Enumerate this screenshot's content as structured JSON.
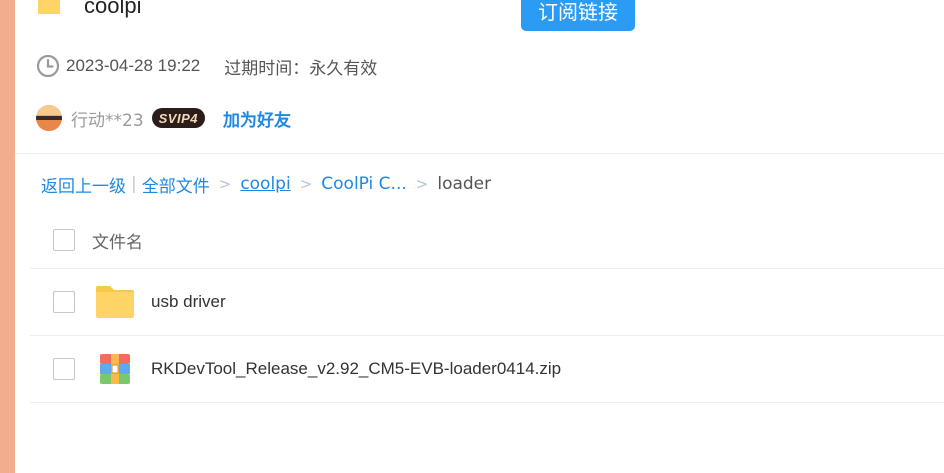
{
  "share": {
    "title": "coolpi",
    "subscribe_label": "订阅链接",
    "created_at": "2023-04-28 19:22",
    "expiry": "过期时间：永久有效"
  },
  "user": {
    "name": "行动**23",
    "badge": "SVIP4",
    "add_friend_label": "加为好友"
  },
  "breadcrumb": {
    "back_label": "返回上一级",
    "separator": "|",
    "all_files_label": "全部文件",
    "items": [
      "coolpi",
      "CoolPi C...",
      "loader"
    ],
    "arrow": ">"
  },
  "file_list": {
    "column_title": "文件名",
    "files": [
      {
        "name": "usb driver",
        "icon": "folder-icon"
      },
      {
        "name": "RKDevTool_Release_v2.92_CM5-EVB-loader0414.zip",
        "icon": "zip-archive-icon"
      }
    ]
  },
  "colors": {
    "accent": "#2a9cf5",
    "link": "#1e88e5",
    "left_strip": "#f1ad8d",
    "folder": "#ffd466"
  }
}
